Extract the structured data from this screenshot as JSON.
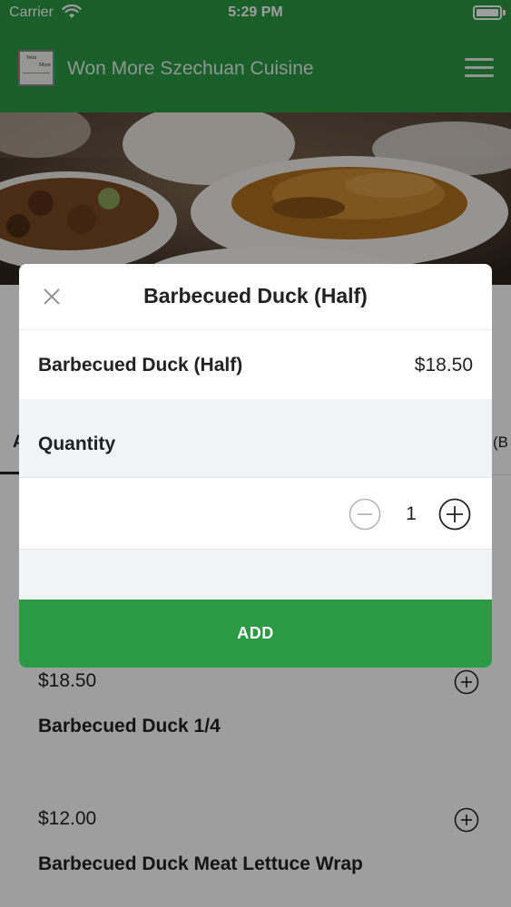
{
  "status_bar": {
    "carrier": "Carrier",
    "time": "5:29 PM"
  },
  "nav": {
    "title": "Won More Szechuan Cuisine",
    "logo_line1": "Won",
    "logo_line2": "More"
  },
  "tabs": {
    "left": "A",
    "right": "(B"
  },
  "menu_items": [
    {
      "price": "$18.50",
      "name": "Barbecued Duck 1/4"
    },
    {
      "price": "$12.00",
      "name": "Barbecued Duck Meat Lettuce Wrap"
    }
  ],
  "modal": {
    "title": "Barbecued Duck (Half)",
    "item_name": "Barbecued Duck (Half)",
    "item_price": "$18.50",
    "quantity_label": "Quantity",
    "quantity_value": "1",
    "add_label": "ADD"
  },
  "colors": {
    "brand_green": "#2a9a45",
    "overlay": "rgba(0,0,0,0.38)"
  },
  "icons": [
    "wifi-icon",
    "battery-icon",
    "hamburger-menu-icon",
    "close-icon",
    "minus-circle-icon",
    "plus-circle-icon"
  ]
}
